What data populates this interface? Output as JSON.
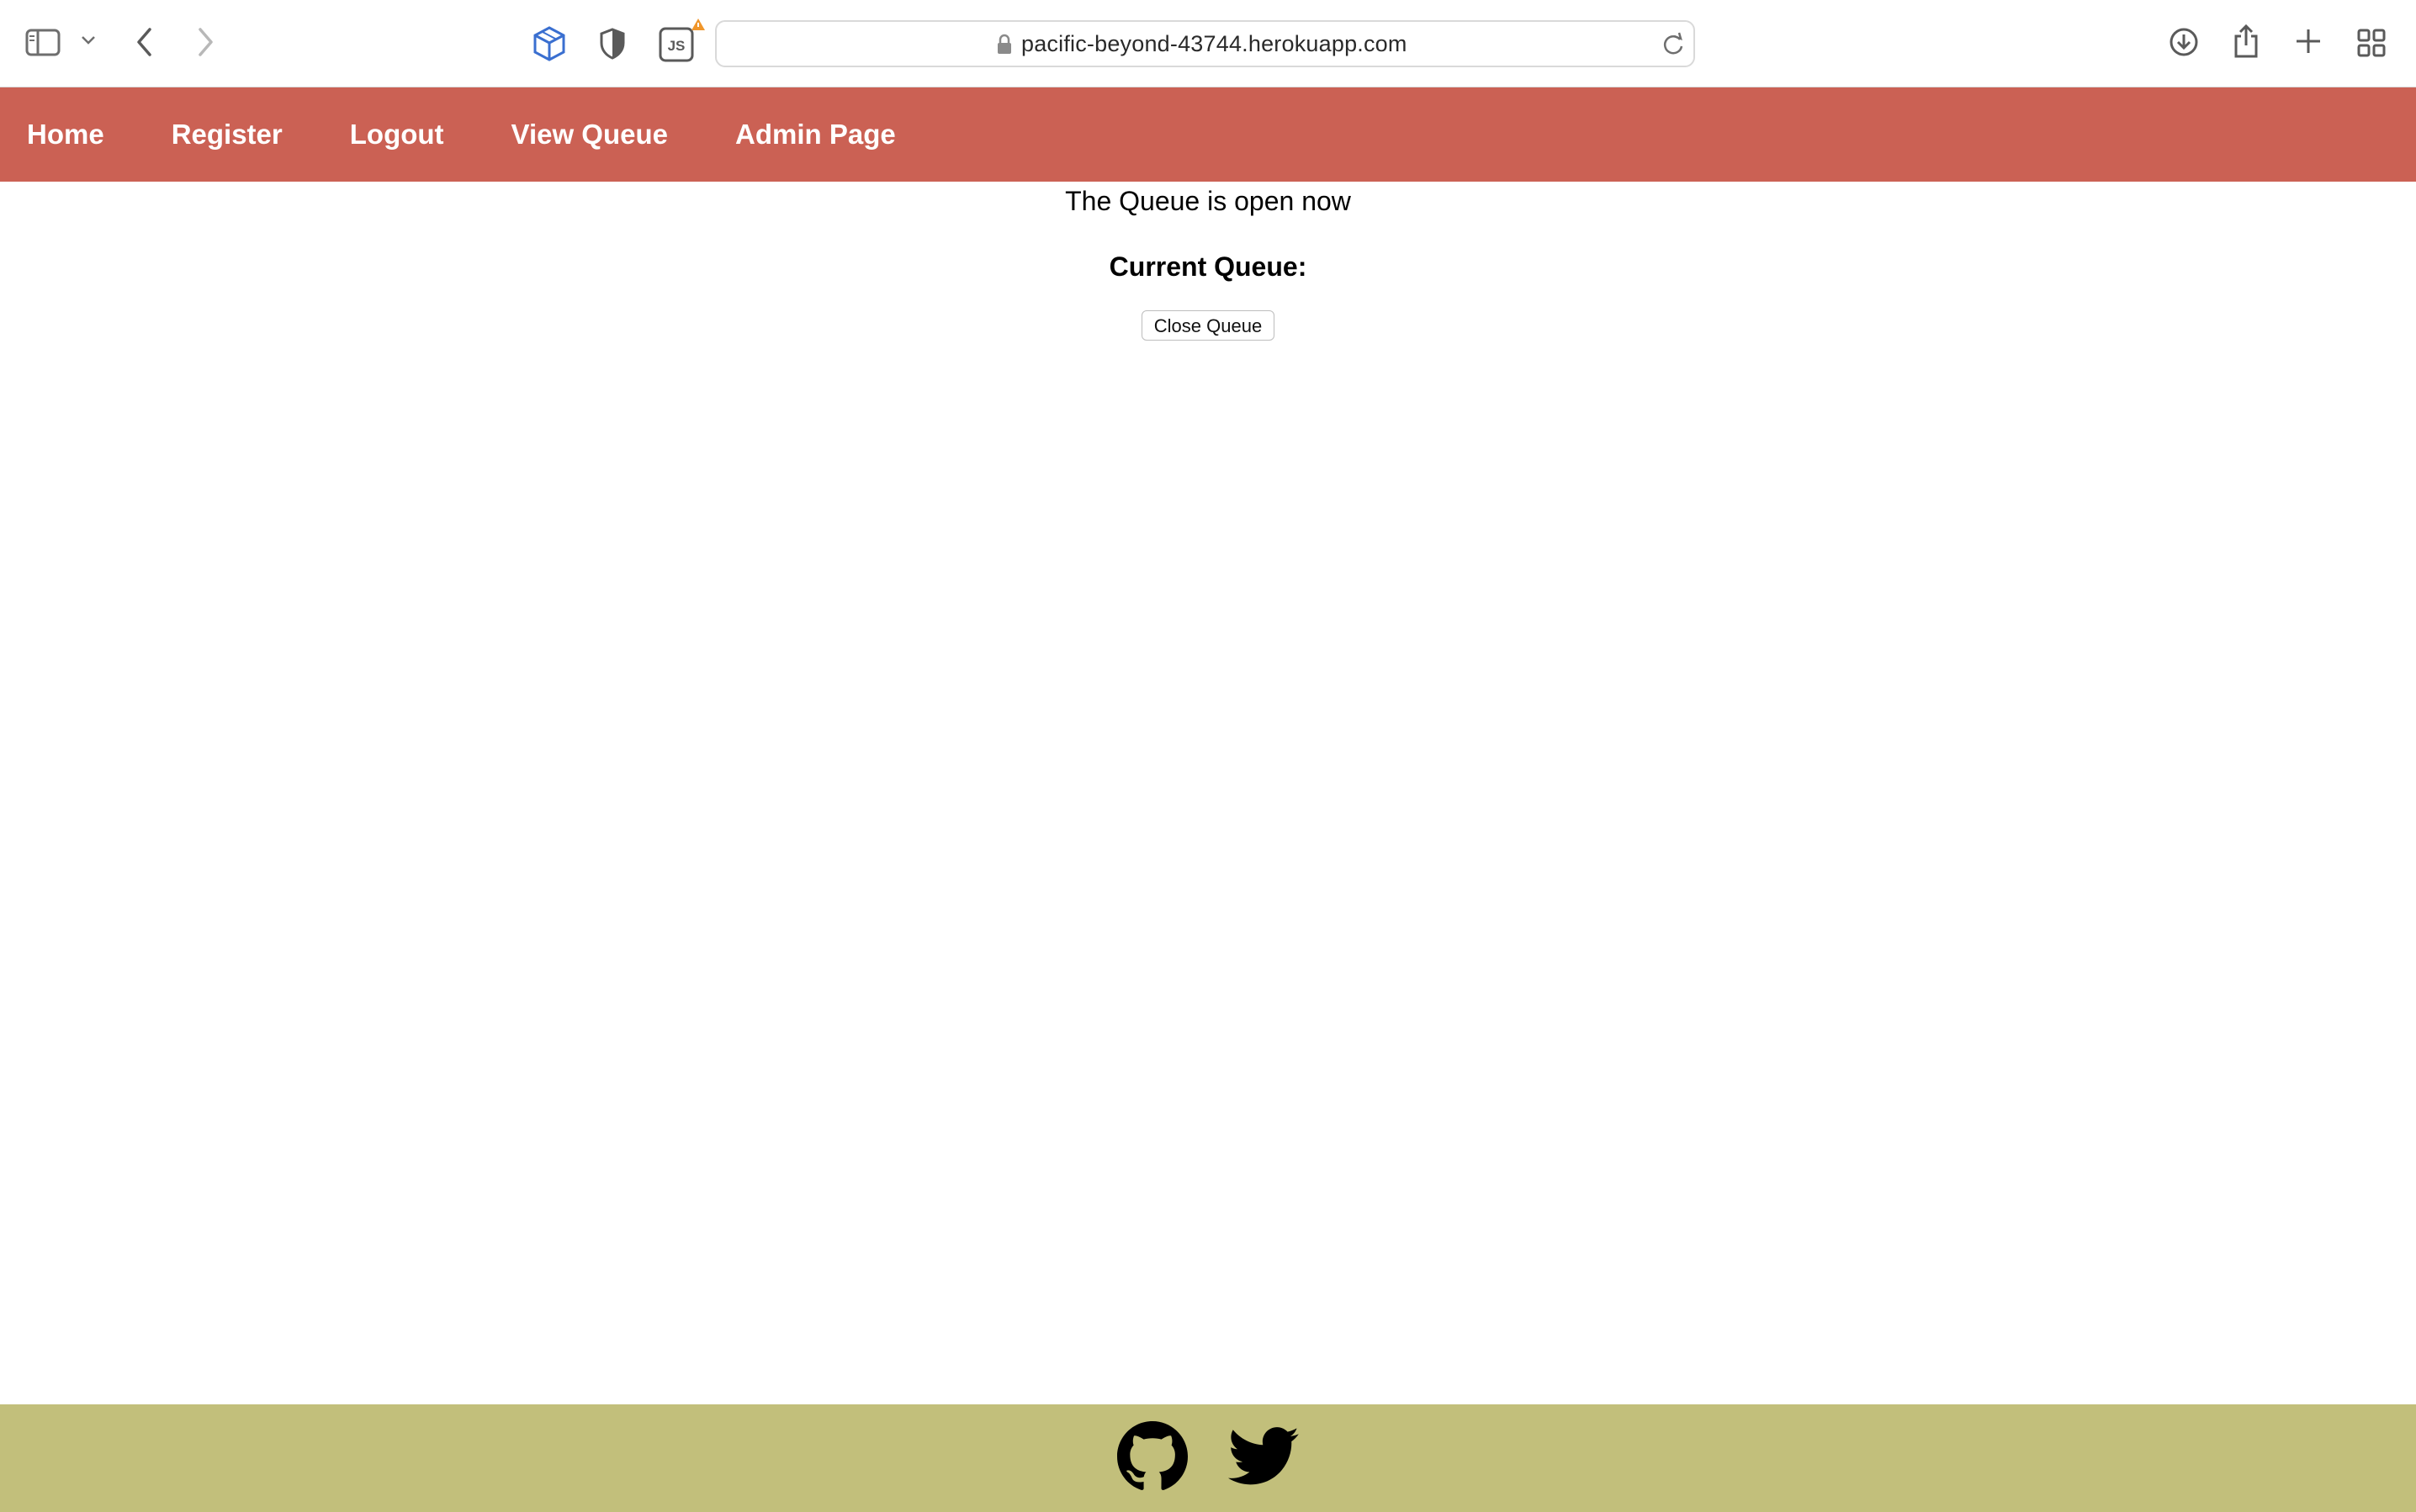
{
  "browser": {
    "url": "pacific-beyond-43744.herokuapp.com",
    "extension_badge_text": "JS",
    "icons": [
      "sidebar-icon",
      "chevron-down-icon",
      "back-icon",
      "forward-icon",
      "cube-icon",
      "shield-icon",
      "js-extension-icon",
      "lock-icon",
      "reload-icon",
      "download-icon",
      "share-icon",
      "new-tab-icon",
      "tab-overview-icon"
    ]
  },
  "nav": {
    "items": [
      {
        "label": "Home"
      },
      {
        "label": "Register"
      },
      {
        "label": "Logout"
      },
      {
        "label": "View Queue"
      },
      {
        "label": "Admin Page"
      }
    ],
    "color": "#cb6154"
  },
  "main": {
    "status_text": "The Queue is open now",
    "queue_heading": "Current Queue:",
    "close_button_label": "Close Queue"
  },
  "footer": {
    "color": "#c2bf7b",
    "icons": [
      "github-icon",
      "twitter-icon"
    ]
  }
}
